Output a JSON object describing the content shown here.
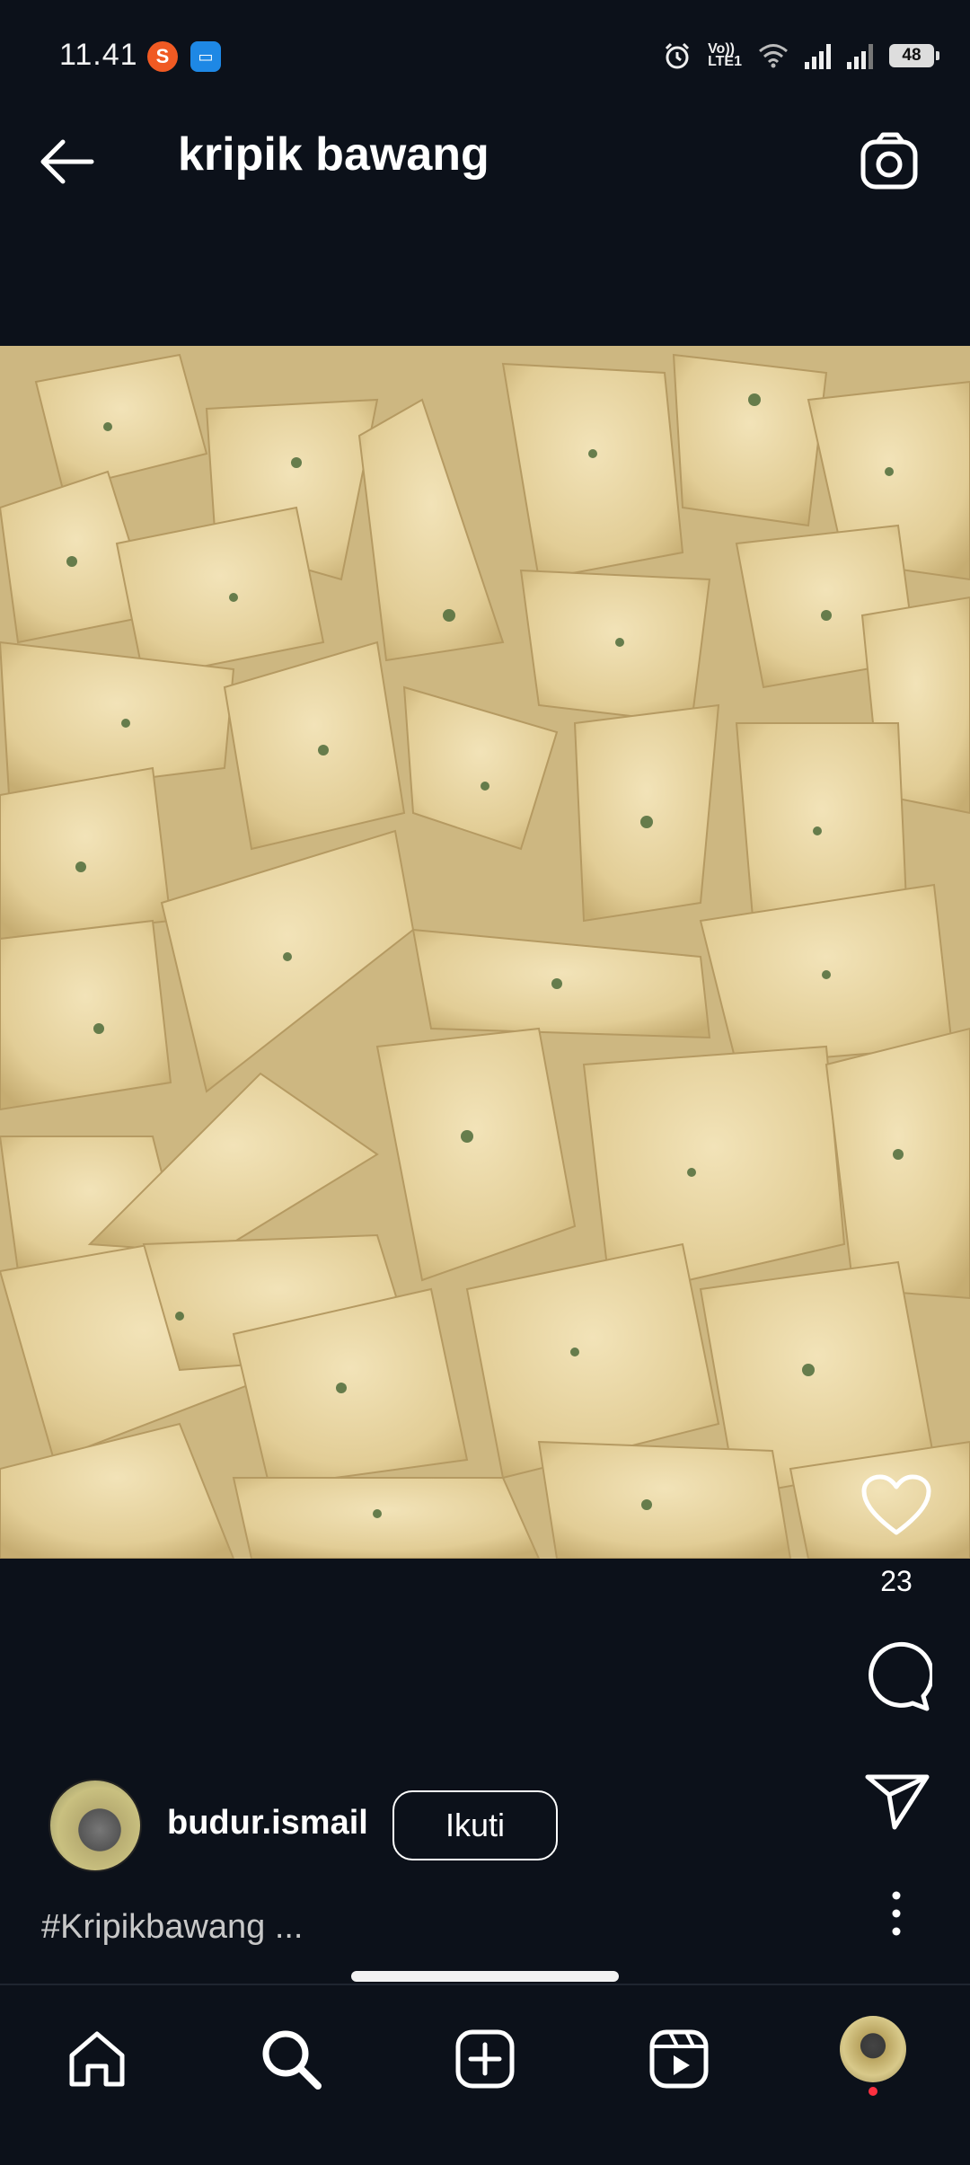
{
  "status_bar": {
    "time": "11.41",
    "battery": "48",
    "network_label_top": "Vo))",
    "network_label_bottom": "LTE1"
  },
  "header": {
    "title": "kripik bawang"
  },
  "post": {
    "likes": "23",
    "username": "budur.ismail",
    "follow_label": "Ikuti",
    "caption": "#Kripikbawang ..."
  },
  "colors": {
    "background": "#0c111a",
    "notification_dot": "#ff3040"
  },
  "icons": {
    "back": "arrow-left-icon",
    "camera": "camera-icon",
    "like": "heart-icon",
    "comment": "comment-bubble-icon",
    "share": "paper-plane-icon",
    "more": "vertical-dots-icon",
    "home": "home-icon",
    "search": "search-icon",
    "create": "plus-square-icon",
    "reels": "reels-icon"
  }
}
